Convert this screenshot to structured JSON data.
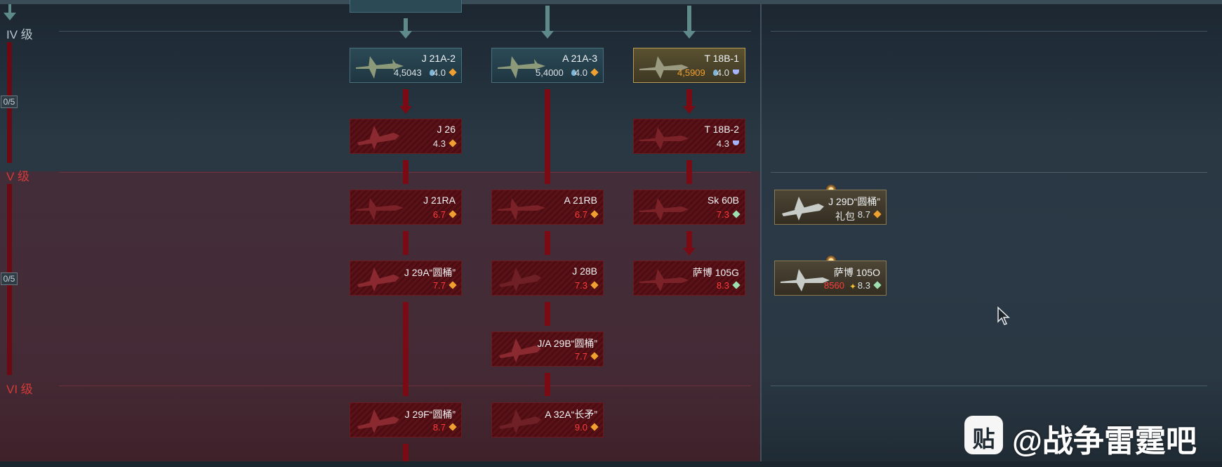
{
  "ranks": [
    {
      "label": "IV 级",
      "state": "unlocked"
    },
    {
      "label": "V 级",
      "state": "locked"
    },
    {
      "label": "VI 级",
      "state": "locked"
    }
  ],
  "progress": [
    {
      "label": "0/5"
    },
    {
      "label": "0/5"
    }
  ],
  "vehicles": {
    "j21a2": {
      "name": "J 21A-2",
      "rp": "4,5043",
      "br": "4.0",
      "mode": "orange"
    },
    "a21a3": {
      "name": "A 21A-3",
      "rp": "5,4000",
      "br": "4.0",
      "mode": "orange"
    },
    "t18b1": {
      "name": "T 18B-1",
      "rp": "4,5909",
      "br": "4.0",
      "mode": "blue"
    },
    "j26": {
      "name": "J 26",
      "br": "4.3",
      "mode": "orange"
    },
    "t18b2": {
      "name": "T 18B-2",
      "br": "4.3",
      "mode": "blue"
    },
    "j21ra": {
      "name": "J 21RA",
      "br": "6.7",
      "mode": "orange"
    },
    "a21rb": {
      "name": "A 21RB",
      "br": "6.7",
      "mode": "orange"
    },
    "sk60b": {
      "name": "Sk 60B",
      "br": "7.3",
      "mode": "green"
    },
    "j29a": {
      "name": "J 29A“圆桶”",
      "br": "7.7",
      "mode": "orange"
    },
    "j28b": {
      "name": "J 28B",
      "br": "7.3",
      "mode": "orange"
    },
    "saab105g": {
      "name": "萨博 105G",
      "br": "8.3",
      "mode": "green"
    },
    "ja29b": {
      "name": "J/A 29B“圆桶”",
      "br": "7.7",
      "mode": "orange"
    },
    "j29f": {
      "name": "J 29F“圆桶”",
      "br": "8.7",
      "mode": "orange"
    },
    "a32a": {
      "name": "A 32A“长矛”",
      "br": "9.0",
      "mode": "orange"
    },
    "j29d": {
      "name": "J 29D“圆桶”",
      "extra": "礼包",
      "br": "8.7",
      "mode": "orange"
    },
    "saab105o": {
      "name": "萨博 105O",
      "rp": "8560",
      "br": "8.3",
      "mode": "green"
    }
  },
  "colors": {
    "locked_red": "#ff3c3c",
    "researched_teal": "#2b4a56",
    "in_research_gold": "#5a5130",
    "premium_brown": "#4d4535"
  },
  "watermark": {
    "icon": "贴",
    "text": "@战争雷霆吧"
  }
}
